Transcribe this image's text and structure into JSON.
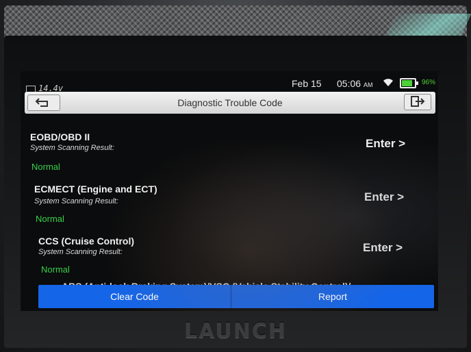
{
  "status": {
    "voltage": "14.4v",
    "date": "Feb 15",
    "time": "05:06",
    "ampm": "AM",
    "battery": "96%",
    "battery_fraction": 0.96,
    "icons": [
      "battery-car-icon",
      "wifi-icon",
      "battery-icon"
    ]
  },
  "header": {
    "title": "Diagnostic Trouble Code",
    "back_icon": "back-arrow-icon",
    "exit_icon": "exit-icon"
  },
  "systems": [
    {
      "name": "EOBD/OBD II",
      "label": "System Scanning Result:",
      "result": "Normal",
      "action": "Enter >"
    },
    {
      "name": "ECMECT (Engine and ECT)",
      "label": "System Scanning Result:",
      "result": "Normal",
      "action": "Enter >"
    },
    {
      "name": "CCS (Cruise Control)",
      "label": "System Scanning Result:",
      "result": "Normal",
      "action": "Enter >"
    }
  ],
  "partial_item": "ABS (Anti-lock Braking System)/VSC (Vehicle Stability Control)/",
  "footer": {
    "clear_label": "Clear Code",
    "report_label": "Report"
  },
  "device": {
    "brand": "LAUNCH"
  },
  "colors": {
    "accent": "#1565e8",
    "ok": "#36d14a"
  }
}
